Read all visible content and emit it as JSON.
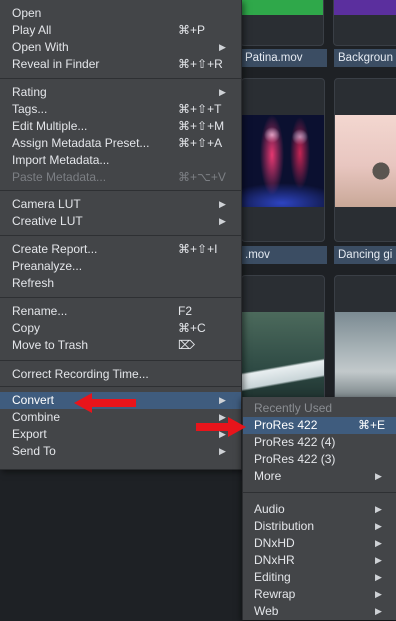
{
  "thumbnails": [
    {
      "name": "Patina.mov"
    },
    {
      "name": "Backgroun"
    },
    {
      "name": ".mov"
    },
    {
      "name": "Dancing gi"
    },
    {
      "name": ""
    },
    {
      "name": ""
    }
  ],
  "menu": {
    "groups": [
      [
        {
          "label": "Open",
          "shortcut": "",
          "submenu": false,
          "disabled": false
        },
        {
          "label": "Play All",
          "shortcut": "⌘+P",
          "submenu": false,
          "disabled": false
        },
        {
          "label": "Open With",
          "shortcut": "",
          "submenu": true,
          "disabled": false
        },
        {
          "label": "Reveal in Finder",
          "shortcut": "⌘+⇧+R",
          "submenu": false,
          "disabled": false
        }
      ],
      [
        {
          "label": "Rating",
          "shortcut": "",
          "submenu": true,
          "disabled": false
        },
        {
          "label": "Tags...",
          "shortcut": "⌘+⇧+T",
          "submenu": false,
          "disabled": false
        },
        {
          "label": "Edit Multiple...",
          "shortcut": "⌘+⇧+M",
          "submenu": false,
          "disabled": false
        },
        {
          "label": "Assign Metadata Preset...",
          "shortcut": "⌘+⇧+A",
          "submenu": false,
          "disabled": false
        },
        {
          "label": "Import Metadata...",
          "shortcut": "",
          "submenu": false,
          "disabled": false
        },
        {
          "label": "Paste Metadata...",
          "shortcut": "⌘+⌥+V",
          "submenu": false,
          "disabled": true
        }
      ],
      [
        {
          "label": "Camera LUT",
          "shortcut": "",
          "submenu": true,
          "disabled": false
        },
        {
          "label": "Creative LUT",
          "shortcut": "",
          "submenu": true,
          "disabled": false
        }
      ],
      [
        {
          "label": "Create Report...",
          "shortcut": "⌘+⇧+I",
          "submenu": false,
          "disabled": false
        },
        {
          "label": "Preanalyze...",
          "shortcut": "",
          "submenu": false,
          "disabled": false
        },
        {
          "label": "Refresh",
          "shortcut": "",
          "submenu": false,
          "disabled": false
        }
      ],
      [
        {
          "label": "Rename...",
          "shortcut": "F2",
          "submenu": false,
          "disabled": false
        },
        {
          "label": "Copy",
          "shortcut": "⌘+C",
          "submenu": false,
          "disabled": false
        },
        {
          "label": "Move to Trash",
          "shortcut": "⌦",
          "submenu": false,
          "disabled": false
        }
      ],
      [
        {
          "label": "Correct Recording Time...",
          "shortcut": "",
          "submenu": false,
          "disabled": false
        }
      ],
      [
        {
          "label": "Convert",
          "shortcut": "",
          "submenu": true,
          "disabled": false,
          "highlighted": true
        },
        {
          "label": "Combine",
          "shortcut": "",
          "submenu": true,
          "disabled": false
        },
        {
          "label": "Export",
          "shortcut": "",
          "submenu": true,
          "disabled": false
        },
        {
          "label": "Send To",
          "shortcut": "",
          "submenu": true,
          "disabled": false
        }
      ]
    ]
  },
  "submenu": {
    "header": "Recently Used",
    "recent": [
      {
        "label": "ProRes 422",
        "shortcut": "⌘+E",
        "submenu": false,
        "highlighted": true
      },
      {
        "label": "ProRes 422 (4)",
        "shortcut": "",
        "submenu": false
      },
      {
        "label": "ProRes 422 (3)",
        "shortcut": "",
        "submenu": false
      },
      {
        "label": "More",
        "shortcut": "",
        "submenu": true
      }
    ],
    "formats": [
      {
        "label": "Audio",
        "submenu": true
      },
      {
        "label": "Distribution",
        "submenu": true
      },
      {
        "label": "DNxHD",
        "submenu": true
      },
      {
        "label": "DNxHR",
        "submenu": true
      },
      {
        "label": "Editing",
        "submenu": true
      },
      {
        "label": "Rewrap",
        "submenu": true
      },
      {
        "label": "Web",
        "submenu": true
      }
    ]
  },
  "icons": {
    "submenu_arrow": "▶",
    "annotation": "red-arrow-icon"
  },
  "colors": {
    "menu_bg": "#434548",
    "highlight": "#3f5c7e",
    "annotation_red": "#e8141b",
    "filename_bar": "#3b4d63"
  }
}
